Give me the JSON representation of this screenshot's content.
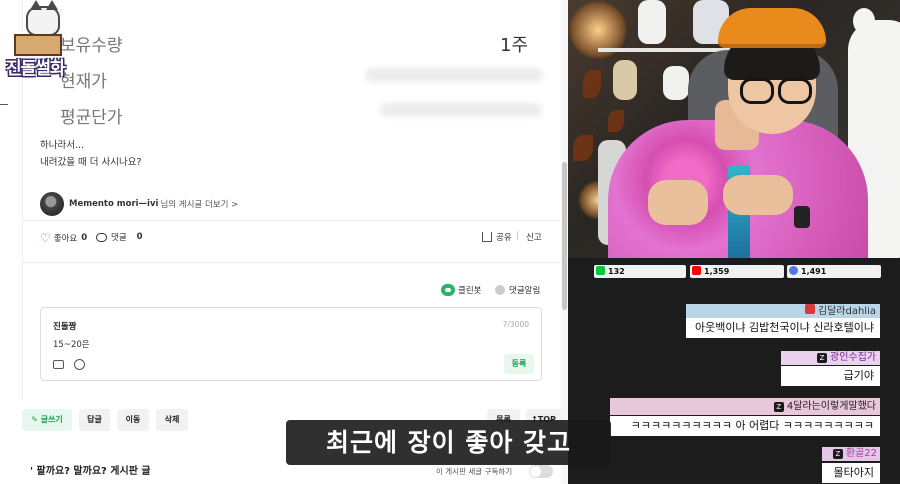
{
  "logo": {
    "text": "진돌썰화"
  },
  "stats": {
    "quantity_label": "보유수량",
    "quantity_value": "1주",
    "current_price_label": "현재가",
    "avg_price_label": "평균단가"
  },
  "post": {
    "line1": "하나라서...",
    "line2": "내려갔을 때 더 사시나요?"
  },
  "author": {
    "name": "Memento mori—ivi",
    "suffix": "님의 게시글 더보기 >"
  },
  "actions": {
    "like_label": "좋아요",
    "like_count": "0",
    "comment_label": "댓글",
    "comment_count": "0",
    "share_label": "공유",
    "report_label": "신고"
  },
  "options": {
    "cleanbot_label": "클린봇",
    "alarm_label": "댓글알림"
  },
  "comment_box": {
    "user": "진돌짱",
    "char_count": "7/3000",
    "text": "15~20은",
    "submit_label": "등록"
  },
  "buttons": {
    "write": "글쓰기",
    "reply": "답글",
    "move": "이동",
    "delete": "삭제",
    "list": "목록",
    "top": "TOP"
  },
  "footer": {
    "board_title": "팔까요? 말까요? 게시판 글",
    "right_text": "이 게시판 새글 구독하기"
  },
  "stream": {
    "stat_chzzk": "132",
    "stat_youtube": "1,359",
    "stat_soop": "1,491",
    "colors": {
      "chzzk": "#00c73c",
      "youtube": "#ff0000",
      "soop": "#4f7ae8"
    }
  },
  "chat": [
    {
      "name": "김달라dahlia",
      "message": "아웃백이냐 김밥천국이냐 신라호텔이냐"
    },
    {
      "name": "광인수집가",
      "message": "급기야"
    },
    {
      "name": "4달라는이렇게말했다",
      "message": "ㅋㅋㅋㅋㅋㅋㅋㅋㅋㅋ 아 어렵다 ㅋㅋㅋㅋㅋㅋㅋㅋㅋ"
    },
    {
      "name": "환골22",
      "message": "몰타아지"
    }
  ],
  "subtitle": "최근에 장이 좋아 갖고"
}
